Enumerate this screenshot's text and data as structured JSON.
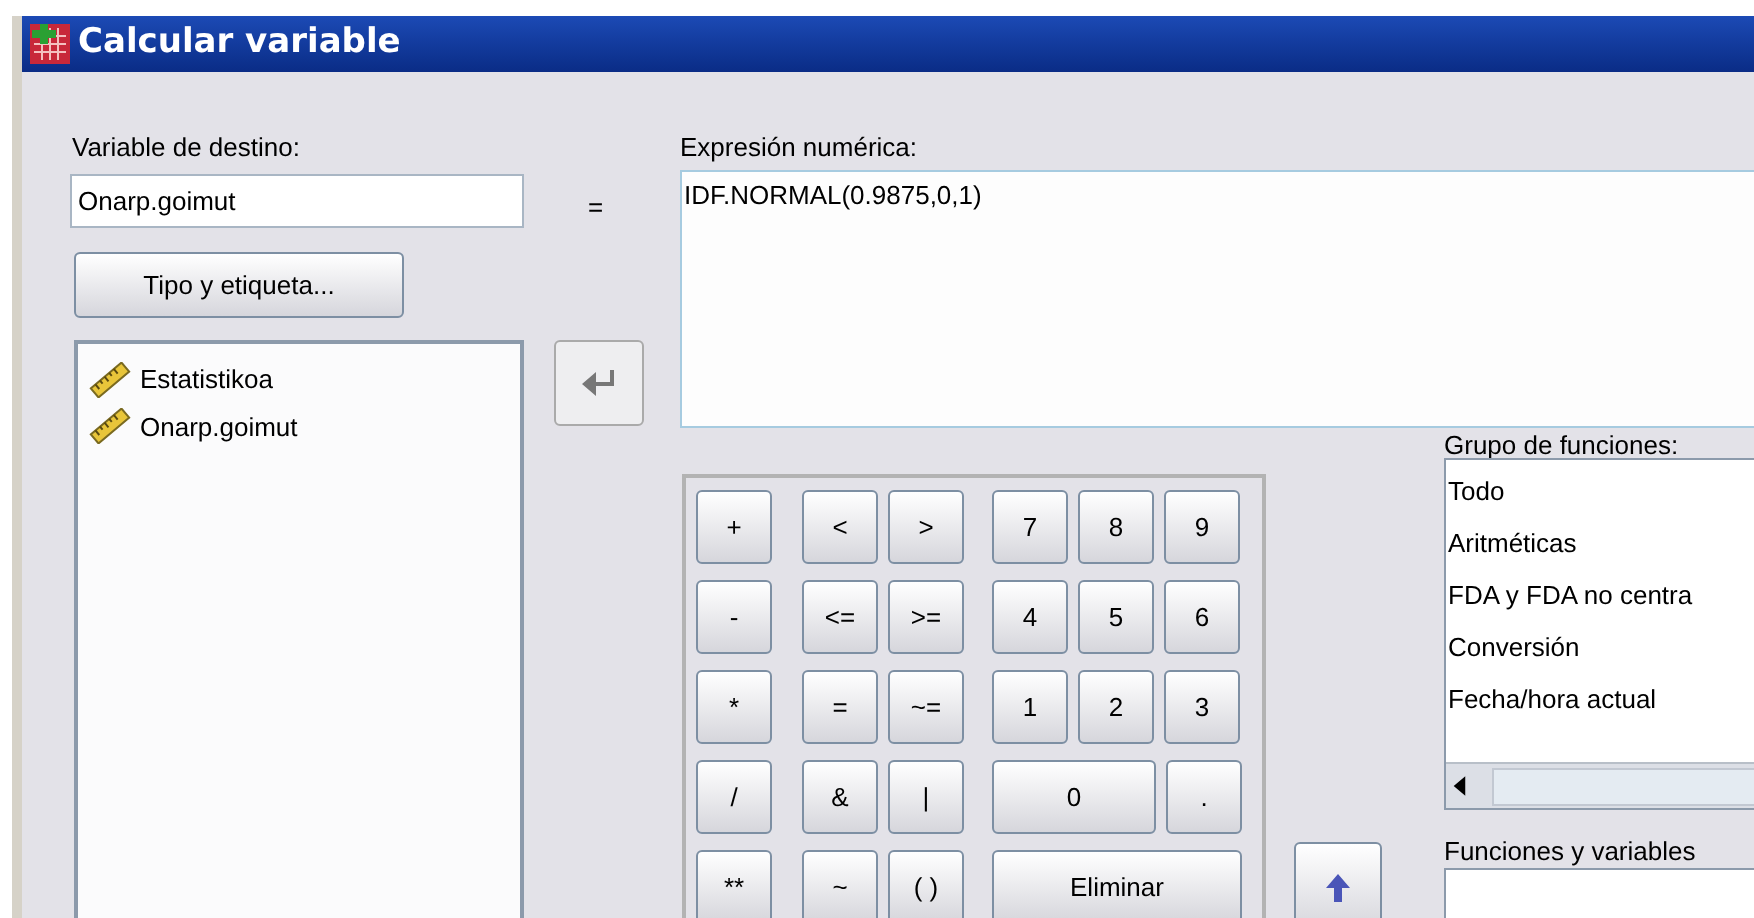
{
  "window": {
    "title": "Calcular variable"
  },
  "target_variable": {
    "label": "Variable de destino:",
    "value": "Onarp.goimut"
  },
  "equals": "=",
  "type_label_button": "Tipo y etiqueta...",
  "variables": [
    {
      "name": "Estatistikoa"
    },
    {
      "name": "Onarp.goimut"
    }
  ],
  "expression": {
    "label": "Expresión numérica:",
    "value": "IDF.NORMAL(0.9875,0,1)"
  },
  "keypad": [
    [
      "+",
      "<",
      ">",
      "7",
      "8",
      "9"
    ],
    [
      "-",
      "<=",
      ">=",
      "4",
      "5",
      "6"
    ],
    [
      "*",
      "=",
      "~=",
      "1",
      "2",
      "3"
    ],
    [
      "/",
      "&",
      "|",
      "0",
      "."
    ],
    [
      "**",
      "~",
      "( )",
      "Eliminar"
    ]
  ],
  "function_group": {
    "label": "Grupo de funciones:",
    "items": [
      "Todo",
      "Aritméticas",
      "FDA y FDA no centra",
      "Conversión",
      "Fecha/hora actual"
    ]
  },
  "functions_and_variables": {
    "label": "Funciones y variables"
  }
}
